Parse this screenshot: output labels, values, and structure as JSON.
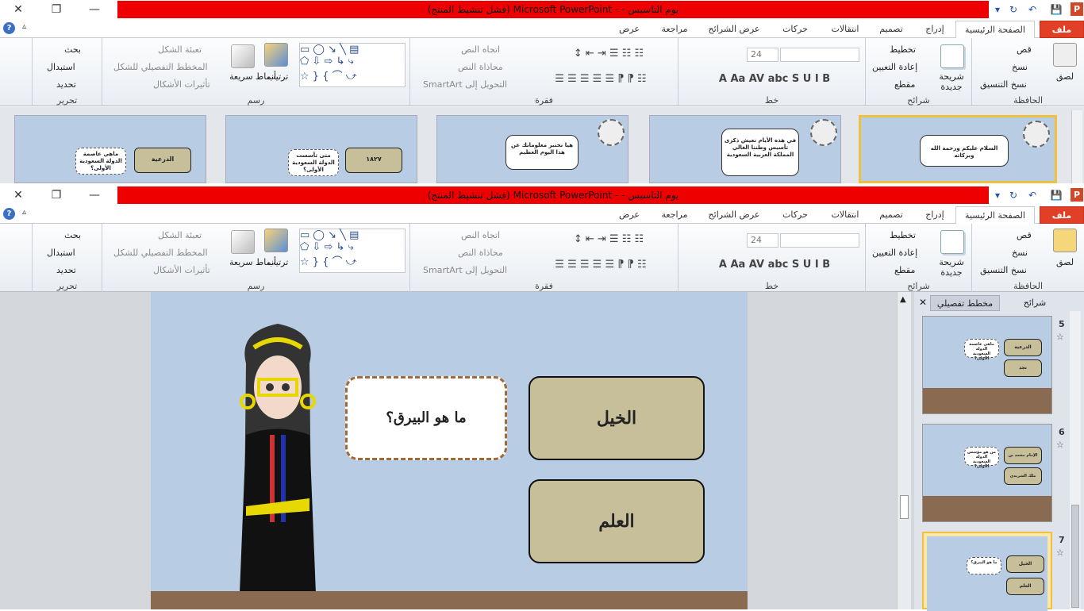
{
  "window": {
    "title": "يوم التاسيس -  - Microsoft PowerPoint (فشل تنشيط المنتج)",
    "close_glyph": "✕",
    "restore_glyph": "❐",
    "min_glyph": "—",
    "app_icon": "P"
  },
  "qat": {
    "dropdown": "▾",
    "redo": "↻",
    "undo": "↶",
    "undo_arrow": "▾",
    "save": "💾"
  },
  "tabs": {
    "file": "ملف",
    "home": "الصفحة الرئيسية",
    "insert": "إدراج",
    "design": "تصميم",
    "transitions": "انتقالات",
    "animations": "حركات",
    "slideshow": "عرض الشرائح",
    "review": "مراجعة",
    "view": "عرض",
    "help": "?",
    "collapse": "▵"
  },
  "clipboard": {
    "paste": "لصق",
    "cut": "قص",
    "copy": "نسخ",
    "format_painter": "نسخ التنسيق",
    "label": "الحافظة"
  },
  "slides_grp": {
    "new_slide": "شريحة جديدة",
    "layout": "تخطيط",
    "reset": "إعادة التعيين",
    "section": "مقطع",
    "label": "شرائح"
  },
  "font": {
    "size": "24",
    "bold": "B",
    "italic": "I",
    "underline": "U",
    "shadow": "S",
    "strike": "abc",
    "spacing": "AV",
    "case": "Aa",
    "color": "A",
    "grow": "A",
    "shrink": "A",
    "clear": "A",
    "label": "خط"
  },
  "paragraph": {
    "text_direction": "اتجاه النص",
    "align_text": "محاذاة النص",
    "smartart": "التحويل إلى SmartArt",
    "label": "فقرة"
  },
  "drawing": {
    "arrange": "ترتيب",
    "quick_styles": "أنماط سريعة",
    "fill": "تعبئة الشكل",
    "outline": "المخطط التفصيلي للشكل",
    "effects": "تأثيرات الأشكال",
    "label": "رسم"
  },
  "editing": {
    "find": "بحث",
    "replace": "استبدال",
    "select": "تحديد",
    "label": "تحرير"
  },
  "top_thumbs": [
    {
      "bubble": "السلام عليكم ورحمة الله وبركاته"
    },
    {
      "bubble": "في هذه الأيام نعيش ذكرى تأسيس وطننا الغالي المملكة العربية السعودية"
    },
    {
      "bubble": "هيا نختبر معلوماتك عن هذا اليوم العظيم"
    },
    {
      "question": "متى تأسست الدولة السعودية الأولى؟",
      "answer": "١٨٢٧"
    },
    {
      "question": "ماهي عاصمة الدولة السعودية الأولى؟",
      "answer": "الدرعية"
    }
  ],
  "slide": {
    "question": "ما هو البيرق؟",
    "answer1": "الخيل",
    "answer2": "العلم"
  },
  "panel": {
    "tab_slides": "شرائح",
    "tab_outline": "مخطط تفصيلي",
    "close": "✕"
  },
  "panel_slides": [
    {
      "num": "5",
      "question": "ماهي عاصمة الدولة السعودية الأولى؟",
      "a1": "الدرعية",
      "a2": "نجد"
    },
    {
      "num": "6",
      "question": "من هو مؤسس الدولة السعودية الأولى؟",
      "a1": "الإمام محمد بن سعود",
      "a2": "ملك الشريدي"
    },
    {
      "num": "7",
      "question": "ما هو البيرق؟",
      "a1": "الخيل",
      "a2": "العلم"
    }
  ],
  "colors": {
    "title_red": "#ee0000",
    "file_tab": "#e23f27",
    "slide_bg": "#b8cde4",
    "floor": "#8b6a52",
    "answer_box": "#c7bf99",
    "selection": "#f0c040"
  }
}
